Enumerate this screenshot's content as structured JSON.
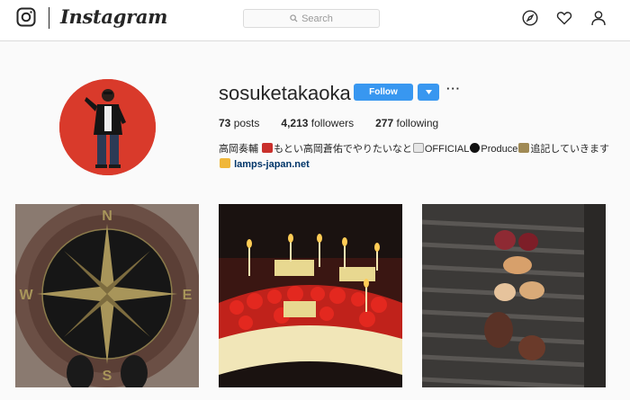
{
  "nav": {
    "wordmark": "Instagram",
    "search_placeholder": "Search"
  },
  "profile": {
    "username": "sosuketakaoka",
    "follow_label": "Follow",
    "more_label": "···",
    "stats": {
      "posts_count": "73",
      "posts_label": "posts",
      "followers_count": "4,213",
      "followers_label": "followers",
      "following_count": "277",
      "following_label": "following"
    },
    "bio": {
      "name": "高岡奏輔",
      "text_1": "もとい高岡蒼佑でやりたいなと",
      "text_2": "OFFICIAL",
      "text_3": "Produce",
      "text_4": "追記していきます",
      "link": "lamps-japan.net"
    }
  },
  "posts": [
    {
      "name": "compass-floor-photo",
      "letters": [
        "N",
        "E",
        "S",
        "W"
      ]
    },
    {
      "name": "birthday-cake-photo"
    },
    {
      "name": "grilled-food-photo"
    }
  ],
  "colors": {
    "accent": "#3897f0",
    "avatar_bg": "#d93a2b",
    "link": "#003569"
  }
}
